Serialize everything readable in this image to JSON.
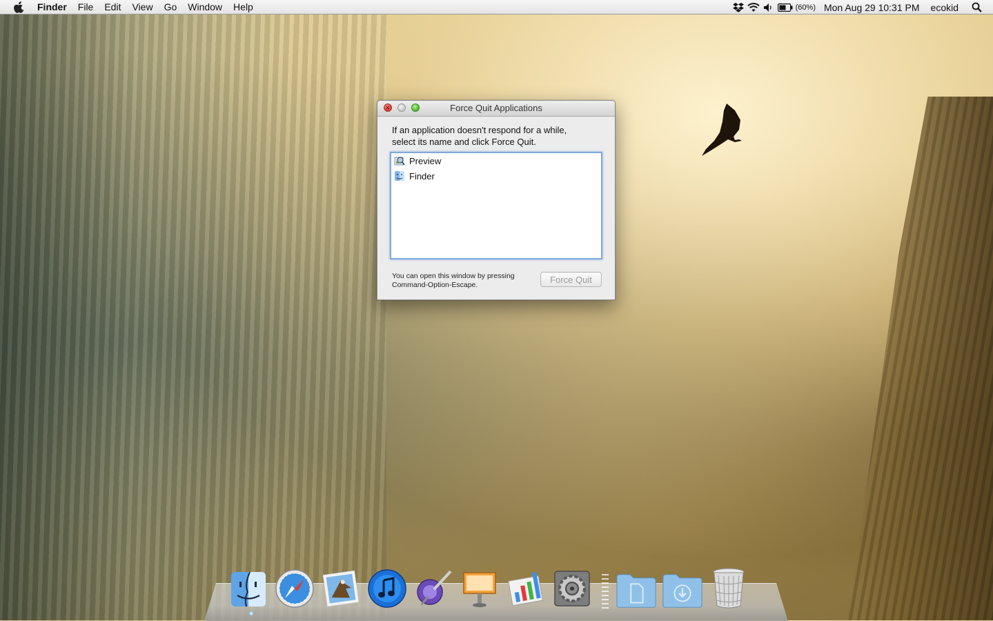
{
  "menubar": {
    "app_name": "Finder",
    "menus": [
      "File",
      "Edit",
      "View",
      "Go",
      "Window",
      "Help"
    ],
    "status": {
      "battery_percent": "(60%)",
      "clock": "Mon Aug 29  10:31 PM",
      "user": "ecokid"
    },
    "icons": [
      "apple-icon",
      "dropbox-icon",
      "wifi-icon",
      "volume-icon",
      "battery-icon",
      "spotlight-icon"
    ]
  },
  "force_quit": {
    "title": "Force Quit Applications",
    "instructions_line1": "If an application doesn't respond for a while,",
    "instructions_line2": "select its name and click Force Quit.",
    "apps": [
      {
        "name": "Preview",
        "icon": "preview-icon"
      },
      {
        "name": "Finder",
        "icon": "finder-icon"
      }
    ],
    "hint_line1": "You can open this window by pressing",
    "hint_line2": "Command-Option-Escape.",
    "button_label": "Force Quit"
  },
  "dock": {
    "items": [
      "finder-icon",
      "safari-icon",
      "mail-icon",
      "itunes-icon",
      "iphoto-icon",
      "keynote-icon",
      "numbers-icon",
      "system-preferences-icon",
      "documents-folder-icon",
      "downloads-folder-icon",
      "trash-icon"
    ],
    "running": [
      "finder-icon"
    ]
  },
  "colors": {
    "list_focus_ring": "#7fa9dc",
    "close_button": "#e0443a",
    "zoom_button": "#5fc33a"
  }
}
